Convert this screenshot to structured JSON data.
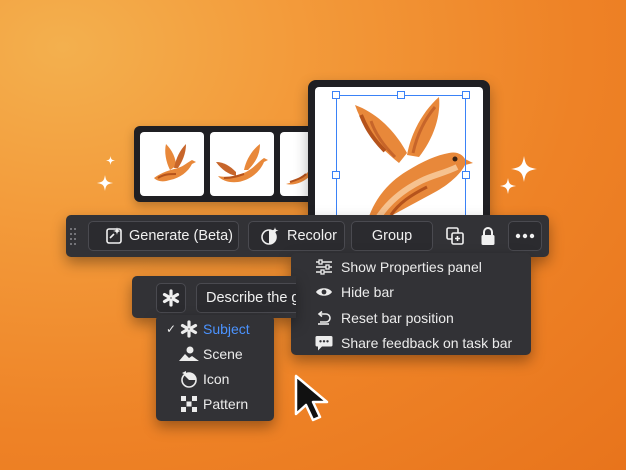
{
  "toolbar": {
    "generate_label": "Generate (Beta)",
    "recolor_label": "Recolor",
    "group_label": "Group",
    "icons": [
      "grip-handle-icon",
      "sparkle-wand-icon",
      "recolor-wand-icon",
      "duplicate-icon",
      "lock-icon",
      "more-options-icon"
    ]
  },
  "overflow_menu": {
    "items": [
      {
        "label": "Show Properties panel",
        "icon": "sliders-icon"
      },
      {
        "label": "Hide bar",
        "icon": "eye-icon"
      },
      {
        "label": "Reset bar position",
        "icon": "reset-icon"
      },
      {
        "label": "Share feedback on task bar",
        "icon": "feedback-icon"
      }
    ]
  },
  "prompt": {
    "placeholder": "Describe the g",
    "style_icon": "asterisk-icon"
  },
  "content_type_menu": {
    "selected": "Subject",
    "items": [
      {
        "label": "Subject",
        "icon": "subject-icon",
        "selected": true
      },
      {
        "label": "Scene",
        "icon": "scene-icon",
        "selected": false
      },
      {
        "label": "Icon",
        "icon": "icon-type-icon",
        "selected": false
      },
      {
        "label": "Pattern",
        "icon": "pattern-icon",
        "selected": false
      }
    ]
  },
  "colors": {
    "background_light": "#f3b04e",
    "background_dark": "#e8741c",
    "panel": "#323236",
    "selection_blue": "#3a82f7",
    "selected_text": "#4b93ff",
    "bird_orange": "#e8883a",
    "bird_dark": "#b5531c"
  }
}
